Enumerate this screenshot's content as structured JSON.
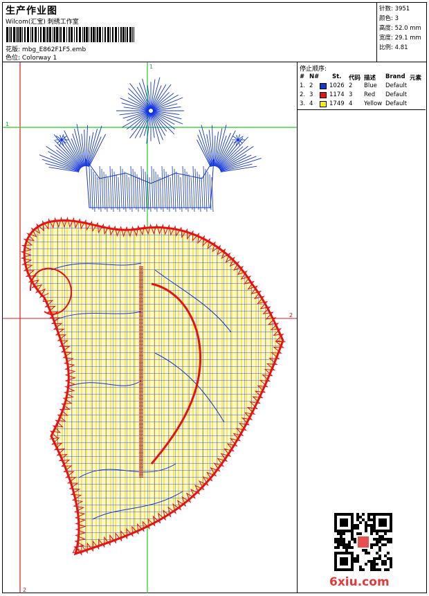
{
  "header": {
    "title": "生产作业图",
    "studio": "Wilcom(汇宝) 刺绣工作室",
    "design_label": "花版:",
    "design_file": "mbg_E862F1F5.emb",
    "colorway_label": "色位:",
    "colorway": "Colorway 1"
  },
  "specs": [
    {
      "label": "针数:",
      "value": "3951"
    },
    {
      "label": "颜色:",
      "value": "3"
    },
    {
      "label": "高度:",
      "value": "52.0 mm"
    },
    {
      "label": "宽度:",
      "value": "29.1 mm"
    },
    {
      "label": "比例:",
      "value": "4.81"
    }
  ],
  "stop_sequence": {
    "title": "停止顺序:",
    "columns": [
      "#",
      "N#",
      "St.",
      "代码",
      "描述",
      "Brand",
      "元素"
    ],
    "rows": [
      {
        "num": "1.",
        "needle": "2",
        "code": "1026",
        "stops": "2",
        "desc": "Blue",
        "brand": "Default",
        "color": "#1034d8"
      },
      {
        "num": "2.",
        "needle": "3",
        "code": "1174",
        "stops": "3",
        "desc": "Red",
        "brand": "Default",
        "color": "#e81010"
      },
      {
        "num": "3.",
        "needle": "4",
        "code": "1749",
        "stops": "4",
        "desc": "Yellow",
        "brand": "Default",
        "color": "#f6f000"
      }
    ]
  },
  "guides": {
    "marker_v1": "1",
    "marker_h1": "1",
    "marker_h2": "2",
    "marker_v2": "2",
    "green": "#22cc22",
    "red": "#e01818"
  },
  "colors": {
    "blue_thread": "#1034d8",
    "red_thread": "#e81010",
    "yellow_thread": "#f2e800",
    "fill_cream": "#fdf7c6"
  },
  "watermark": {
    "site": "6xiu.com"
  }
}
